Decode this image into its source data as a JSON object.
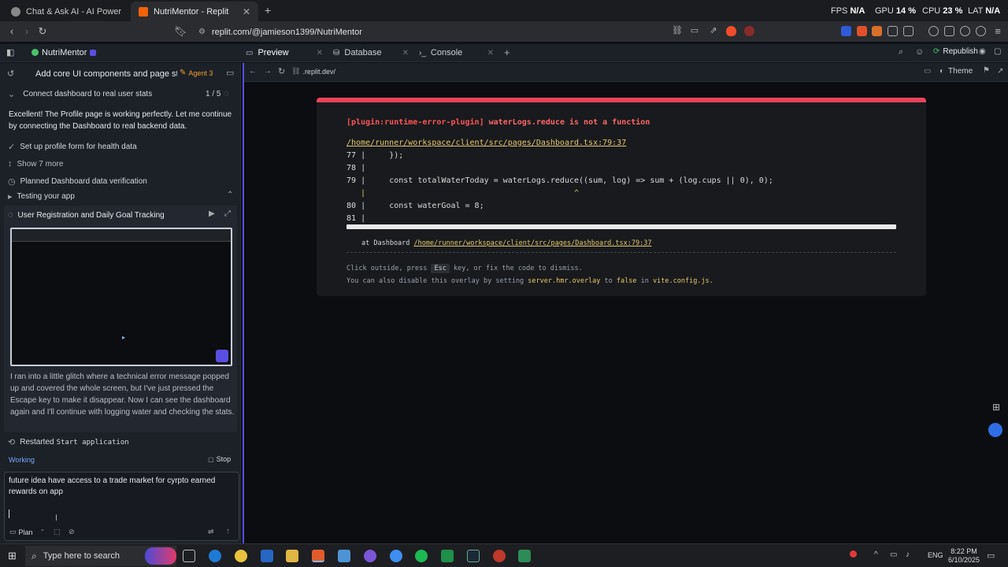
{
  "browser": {
    "tabs": [
      {
        "title": "Chat & Ask AI - AI Powered Chat Bot",
        "active": false
      },
      {
        "title": "NutriMentor - Replit",
        "active": true
      }
    ],
    "new_tab_glyph": "+",
    "stats": {
      "fps_label": "FPS",
      "fps_value": "N/A",
      "gpu_label": "GPU",
      "gpu_value": "14 %",
      "cpu_label": "CPU",
      "cpu_value": "23 %",
      "lat_label": "LAT",
      "lat_value": "N/A"
    },
    "url": "replit.com/@jamieson1399/NutriMentor"
  },
  "replit": {
    "project_name": "NutriMentor",
    "tabs": [
      {
        "label": "Preview"
      },
      {
        "label": "Database"
      },
      {
        "label": "Console"
      }
    ],
    "republish_label": "Republish",
    "theme_label": "Theme",
    "preview_url": ".replit.dev/"
  },
  "agent": {
    "task_title": "Add core UI components and page struct...",
    "agent_badge": "Agent 3",
    "step_title": "Connect dashboard to real user stats",
    "step_count": "1 / 5",
    "message1": "Excellent! The Profile page is working perfectly. Let me continue by connecting the Dashboard to real backend data.",
    "items": [
      "Set up profile form for health data",
      "Show 7 more",
      "Planned Dashboard data verification",
      "Testing your app"
    ],
    "section_title": "User Registration and Daily Goal Tracking",
    "message2": "I ran into a little glitch where a technical error message popped up and covered the whole screen, but I've just pressed the Escape key to make it disappear. Now I can see the dashboard again and I'll continue with logging water and checking the stats.",
    "restarted_label": "Restarted",
    "restarted_cmd": "Start application",
    "status": "Working",
    "stop_label": "Stop",
    "composer_text": "future idea have access to a trade market for cyrpto earned rewards on app",
    "plan_label": "Plan"
  },
  "error": {
    "plugin": "[plugin:runtime-error-plugin]",
    "message": "waterLogs.reduce is not a function",
    "file_link": "/home/runner/workspace/client/src/pages/Dashboard.tsx:79:37",
    "code_lines": [
      {
        "num": "77",
        "code": "    });"
      },
      {
        "num": "78",
        "code": ""
      },
      {
        "num": "79",
        "code": "    const totalWaterToday = waterLogs.reduce((sum, log) => sum + (log.cups || 0), 0);"
      },
      {
        "num": "",
        "code": "                                           ^"
      },
      {
        "num": "80",
        "code": "    const waterGoal = 8;"
      },
      {
        "num": "81",
        "code": ""
      }
    ],
    "stack_prefix": "at Dashboard",
    "stack_link": "/home/runner/workspace/client/src/pages/Dashboard.tsx:79:37",
    "dismiss_1": "Click outside, press",
    "dismiss_key": "Esc",
    "dismiss_2": "key, or fix the code to dismiss.",
    "disable_1": "You can also disable this overlay by setting",
    "disable_setting": "server.hmr.overlay",
    "disable_2": "to",
    "disable_value": "false",
    "disable_3": "in",
    "disable_file": "vite.config.js."
  },
  "taskbar": {
    "search_placeholder": "Type here to search",
    "lang": "ENG",
    "time": "8:22 PM",
    "date": "6/10/2025"
  },
  "colors": {
    "accent": "#5a4fe0",
    "error_bar": "#e8445a",
    "agent_badge": "#f0a030",
    "link_yellow": "#e6c86a"
  }
}
